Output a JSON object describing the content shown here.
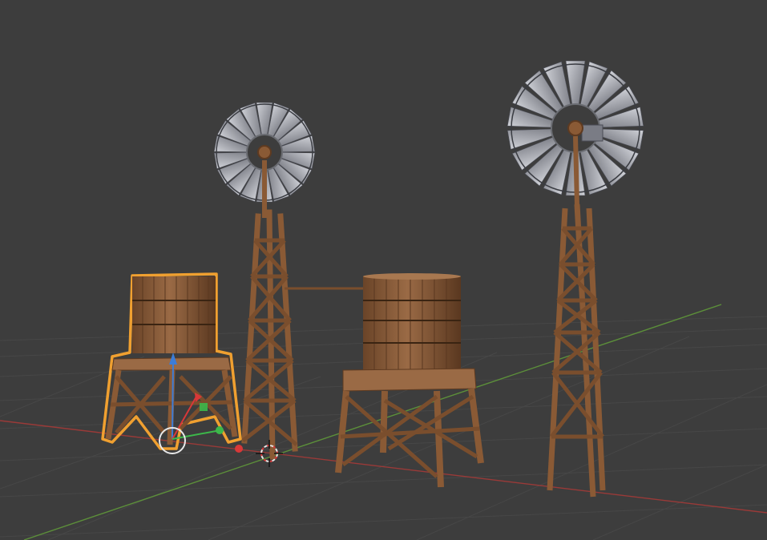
{
  "viewport": {
    "background_color": "#3d3d3d",
    "grid_color": "#474747",
    "x_axis_color": "#9a3a38",
    "y_axis_color": "#5c8f3a"
  },
  "scene": {
    "objects": [
      {
        "name": "water-tower-small",
        "selected": true,
        "outline_color": "#f0a030"
      },
      {
        "name": "windmill-left",
        "selected": false
      },
      {
        "name": "water-tower-large",
        "selected": false
      },
      {
        "name": "windmill-right",
        "selected": false
      }
    ],
    "wood_color": "#8a5a35",
    "wood_dark_color": "#5e3a20",
    "blade_color": "#8a8c95",
    "blade_light_color": "#c5c7cf"
  },
  "gizmo": {
    "z_color": "#3c7dd8",
    "x_color": "#d83838",
    "y_color": "#3cb84a",
    "icons": [
      "move-gizmo-icon",
      "rotate-handle-icon",
      "3d-cursor-icon"
    ]
  }
}
